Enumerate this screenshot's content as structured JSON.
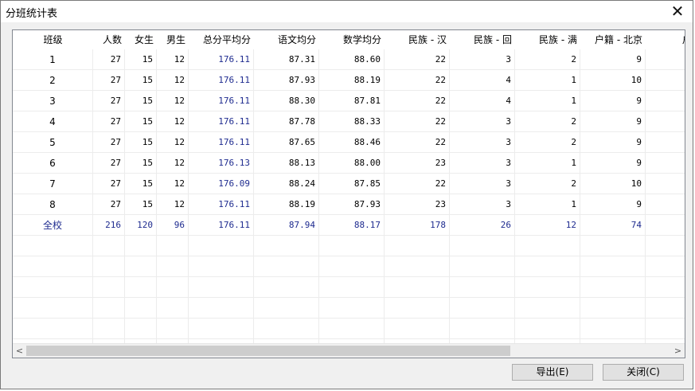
{
  "window": {
    "title": "分班统计表",
    "close_glyph": "✕"
  },
  "table": {
    "headers": [
      "班级",
      "人数",
      "女生",
      "男生",
      "总分平均分",
      "语文均分",
      "数学均分",
      "民族 - 汉",
      "民族 - 回",
      "民族 - 满",
      "户籍 - 北京",
      "户籍 -"
    ],
    "rows": [
      [
        "1",
        "27",
        "15",
        "12",
        "176.11",
        "87.31",
        "88.60",
        "22",
        "3",
        "2",
        "9",
        ""
      ],
      [
        "2",
        "27",
        "15",
        "12",
        "176.11",
        "87.93",
        "88.19",
        "22",
        "4",
        "1",
        "10",
        ""
      ],
      [
        "3",
        "27",
        "15",
        "12",
        "176.11",
        "88.30",
        "87.81",
        "22",
        "4",
        "1",
        "9",
        ""
      ],
      [
        "4",
        "27",
        "15",
        "12",
        "176.11",
        "87.78",
        "88.33",
        "22",
        "3",
        "2",
        "9",
        ""
      ],
      [
        "5",
        "27",
        "15",
        "12",
        "176.11",
        "87.65",
        "88.46",
        "22",
        "3",
        "2",
        "9",
        ""
      ],
      [
        "6",
        "27",
        "15",
        "12",
        "176.13",
        "88.13",
        "88.00",
        "23",
        "3",
        "1",
        "9",
        ""
      ],
      [
        "7",
        "27",
        "15",
        "12",
        "176.09",
        "88.24",
        "87.85",
        "22",
        "3",
        "2",
        "10",
        ""
      ],
      [
        "8",
        "27",
        "15",
        "12",
        "176.11",
        "88.19",
        "87.93",
        "23",
        "3",
        "1",
        "9",
        ""
      ]
    ],
    "total": [
      "全校",
      "216",
      "120",
      "96",
      "176.11",
      "87.94",
      "88.17",
      "178",
      "26",
      "12",
      "74",
      ""
    ],
    "empty_row_count": 6
  },
  "scrollbar": {
    "left_arrow": "<",
    "right_arrow": ">"
  },
  "buttons": {
    "export": "导出(E)",
    "close": "关闭(C)"
  }
}
